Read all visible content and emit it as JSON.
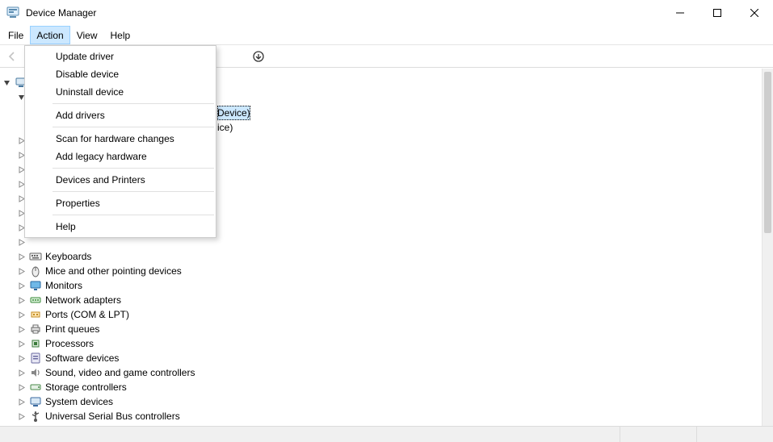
{
  "window": {
    "title": "Device Manager"
  },
  "menubar": {
    "file": "File",
    "action": "Action",
    "view": "View",
    "help": "Help"
  },
  "action_menu": {
    "update_driver": "Update driver",
    "disable_device": "Disable device",
    "uninstall_device": "Uninstall device",
    "add_drivers": "Add drivers",
    "scan_for_hardware_changes": "Scan for hardware changes",
    "add_legacy_hardware": "Add legacy hardware",
    "devices_and_printers": "Devices and Printers",
    "properties": "Properties",
    "help": "Help"
  },
  "toolbar": {
    "back": "back-icon",
    "forward": "forward-icon",
    "refresh": "refresh-icon"
  },
  "tree": {
    "root_expand": "v",
    "audio_expand": "v",
    "peek_selected": "Device)",
    "peek_child": "ice)",
    "categories": [
      {
        "label": "Keyboards",
        "icon": "keyboard"
      },
      {
        "label": "Mice and other pointing devices",
        "icon": "mouse"
      },
      {
        "label": "Monitors",
        "icon": "monitor"
      },
      {
        "label": "Network adapters",
        "icon": "network"
      },
      {
        "label": "Ports (COM & LPT)",
        "icon": "port"
      },
      {
        "label": "Print queues",
        "icon": "printer"
      },
      {
        "label": "Processors",
        "icon": "cpu"
      },
      {
        "label": "Software devices",
        "icon": "software"
      },
      {
        "label": "Sound, video and game controllers",
        "icon": "sound"
      },
      {
        "label": "Storage controllers",
        "icon": "storage"
      },
      {
        "label": "System devices",
        "icon": "system"
      },
      {
        "label": "Universal Serial Bus controllers",
        "icon": "usb"
      }
    ],
    "hidden_rows_above": 7
  },
  "statusbar": {
    "text": ""
  }
}
